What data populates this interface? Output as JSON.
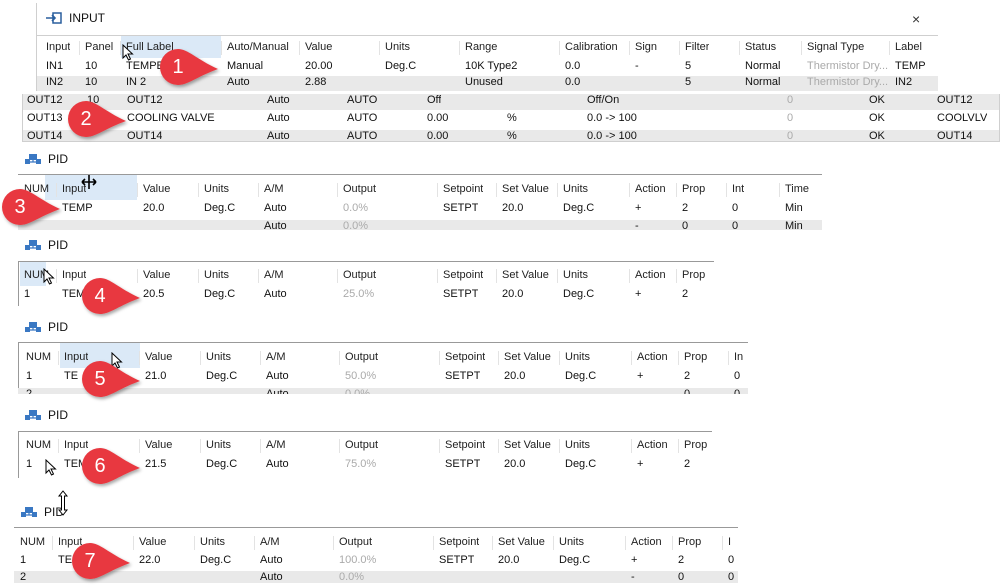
{
  "input_panel": {
    "title": "INPUT",
    "close": "×",
    "headers": [
      "Input",
      "Panel",
      "Full Label",
      "Auto/Manual",
      "Value",
      "Units",
      "Range",
      "Calibration",
      "Sign",
      "Filter",
      "Status",
      "Signal Type",
      "Label"
    ],
    "row1": [
      "IN1",
      "10",
      "TEMPE",
      "Manual",
      "20.00",
      "Deg.C",
      "10K Type2",
      "0.0",
      "-",
      "5",
      "Normal",
      "Thermistor Dry...",
      "TEMP"
    ],
    "row2": [
      "IN2",
      "10",
      "IN 2",
      "Auto",
      "2.88",
      "",
      "Unused",
      "0.0",
      "",
      "5",
      "Normal",
      "Thermistor Dry...",
      "IN2"
    ]
  },
  "output_panel": {
    "rows": [
      [
        "OUT12",
        "10",
        "OUT12",
        "Auto",
        "AUTO",
        "Off",
        "",
        "Off/On",
        "",
        "0",
        "OK",
        "OUT12"
      ],
      [
        "OUT13",
        "",
        "COOLING VALVE",
        "Auto",
        "AUTO",
        "0.00",
        "%",
        "0.0 -> 100",
        "",
        "0",
        "OK",
        "COOLVLV"
      ],
      [
        "OUT14",
        "",
        "OUT14",
        "Auto",
        "AUTO",
        "0.00",
        "%",
        "0.0 -> 100",
        "",
        "0",
        "OK",
        "OUT14"
      ]
    ]
  },
  "pid_title": "PID",
  "pid_headers_a": [
    "NUM",
    "Input",
    "Value",
    "Units",
    "A/M",
    "Output",
    "Setpoint",
    "Set Value",
    "Units",
    "Action",
    "Prop",
    "Int",
    "Time"
  ],
  "pid_headers_b": [
    "NUM",
    "Input",
    "Value",
    "Units",
    "A/M",
    "Output",
    "Setpoint",
    "Set Value",
    "Units",
    "Action",
    "Prop"
  ],
  "pid_headers_c": [
    "NUM",
    "Input",
    "Value",
    "Units",
    "A/M",
    "Output",
    "Setpoint",
    "Set Value",
    "Units",
    "Action",
    "Prop",
    "In"
  ],
  "pid_headers_d": [
    "NUM",
    "Input",
    "Value",
    "Units",
    "A/M",
    "Output",
    "Setpoint",
    "Set Value",
    "Units",
    "Action",
    "Prop",
    "I"
  ],
  "pid1": {
    "row1": [
      "",
      "TEMP",
      "20.0",
      "Deg.C",
      "Auto",
      "0.0%",
      "SETPT",
      "20.0",
      "Deg.C",
      "+",
      "2",
      "0",
      "Min"
    ],
    "row2": [
      "",
      "",
      "",
      "",
      "Auto",
      "0.0%",
      "",
      "",
      "",
      "-",
      "0",
      "0",
      "Min"
    ]
  },
  "pid2": {
    "row1": [
      "1",
      "TEM",
      "20.5",
      "Deg.C",
      "Auto",
      "25.0%",
      "SETPT",
      "20.0",
      "Deg.C",
      "+",
      "2"
    ]
  },
  "pid3": {
    "row1": [
      "1",
      "TE",
      "21.0",
      "Deg.C",
      "Auto",
      "50.0%",
      "SETPT",
      "20.0",
      "Deg.C",
      "+",
      "2",
      "0"
    ],
    "row2": [
      "2",
      "",
      "",
      "",
      "Auto",
      "0.0%",
      "",
      "",
      "",
      "",
      "0",
      "0"
    ]
  },
  "pid4": {
    "row1": [
      "1",
      "TEM",
      "21.5",
      "Deg.C",
      "Auto",
      "75.0%",
      "SETPT",
      "20.0",
      "Deg.C",
      "+",
      "2"
    ]
  },
  "pid5": {
    "row1": [
      "1",
      "TEM",
      "22.0",
      "Deg.C",
      "Auto",
      "100.0%",
      "SETPT",
      "20.0",
      "Deg.C",
      "+",
      "2",
      "0"
    ],
    "row2": [
      "2",
      "",
      "",
      "",
      "Auto",
      "0.0%",
      "",
      "",
      "",
      "-",
      "0",
      "0"
    ]
  },
  "callouts": [
    "1",
    "2",
    "3",
    "4",
    "5",
    "6",
    "7"
  ],
  "colors": {
    "callout_red": "#e8393f",
    "header_selected": "#dbe9f7",
    "grey_row": "#e9e9e9"
  }
}
